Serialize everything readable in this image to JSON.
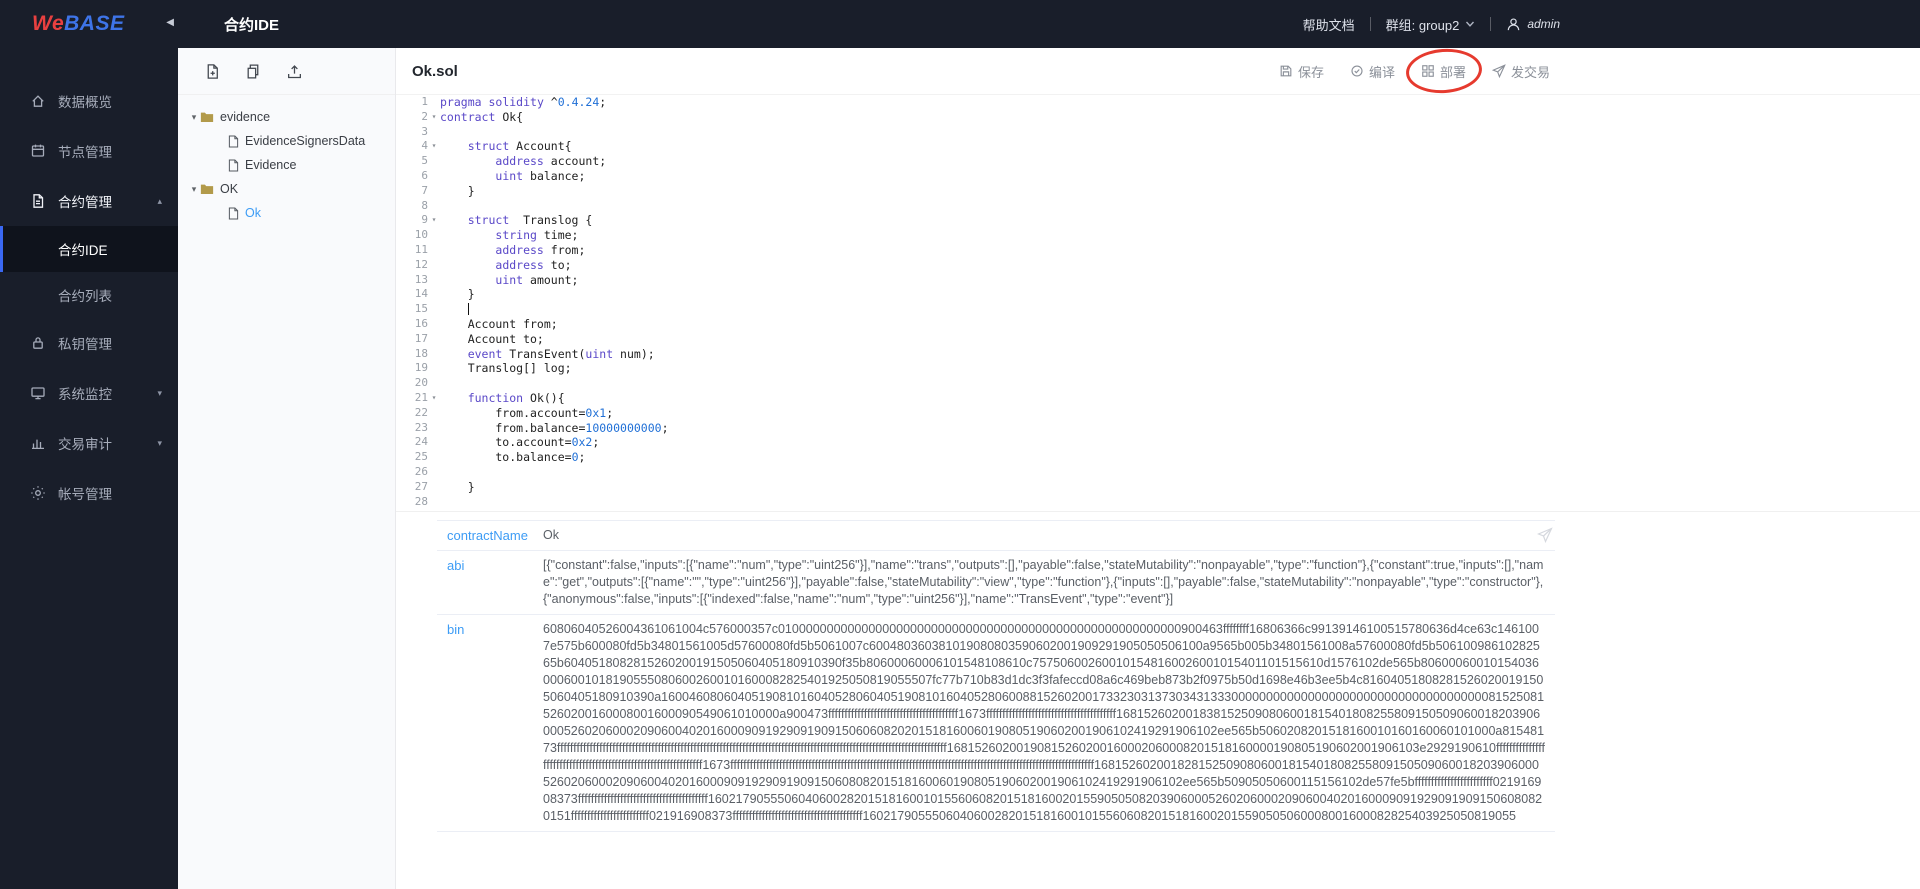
{
  "header": {
    "logo_we": "We",
    "logo_base": "BASE",
    "page_title": "合约IDE",
    "help_link": "帮助文档",
    "group_label": "群组: group2",
    "user_name": "admin"
  },
  "icons": {
    "collapse": "◀",
    "caret_up": "▴",
    "caret_down": "▾",
    "tree_caret": "▾",
    "fold_caret": "▾"
  },
  "sidebar": {
    "items": [
      {
        "label": "数据概览"
      },
      {
        "label": "节点管理"
      },
      {
        "label": "合约管理",
        "expanded": true
      },
      {
        "label": "合约IDE",
        "active": true
      },
      {
        "label": "合约列表"
      },
      {
        "label": "私钥管理"
      },
      {
        "label": "系统监控",
        "collapsed": true
      },
      {
        "label": "交易审计",
        "collapsed": true
      },
      {
        "label": "帐号管理"
      }
    ]
  },
  "file_tree": {
    "folders": [
      {
        "name": "evidence",
        "files": [
          "EvidenceSignersData",
          "Evidence"
        ]
      },
      {
        "name": "OK",
        "files": [
          "Ok"
        ],
        "selected_file": "Ok"
      }
    ]
  },
  "editor": {
    "file_name": "Ok.sol",
    "actions": {
      "save": "保存",
      "compile": "编译",
      "deploy": "部署",
      "send_tx": "发交易"
    },
    "fold_lines": [
      2,
      4,
      9,
      21
    ],
    "cursor_line": 15,
    "lines": [
      "pragma solidity ^0.4.24;",
      "contract Ok{",
      "",
      "    struct Account{",
      "        address account;",
      "        uint balance;",
      "    }",
      "",
      "    struct  Translog {",
      "        string time;",
      "        address from;",
      "        address to;",
      "        uint amount;",
      "    }",
      "    ",
      "    Account from;",
      "    Account to;",
      "    event TransEvent(uint num);",
      "    Translog[] log;",
      "",
      "    function Ok(){",
      "        from.account=0x1;",
      "        from.balance=10000000000;",
      "        to.account=0x2;",
      "        to.balance=0;",
      "",
      "    }",
      ""
    ]
  },
  "output_panel": {
    "rows": [
      {
        "label": "contractName",
        "value": "Ok"
      },
      {
        "label": "abi",
        "value": "[{\"constant\":false,\"inputs\":[{\"name\":\"num\",\"type\":\"uint256\"}],\"name\":\"trans\",\"outputs\":[],\"payable\":false,\"stateMutability\":\"nonpayable\",\"type\":\"function\"},{\"constant\":true,\"inputs\":[],\"name\":\"get\",\"outputs\":[{\"name\":\"\",\"type\":\"uint256\"}],\"payable\":false,\"stateMutability\":\"view\",\"type\":\"function\"},{\"inputs\":[],\"payable\":false,\"stateMutability\":\"nonpayable\",\"type\":\"constructor\"},{\"anonymous\":false,\"inputs\":[{\"indexed\":false,\"name\":\"num\",\"type\":\"uint256\"}],\"name\":\"TransEvent\",\"type\":\"event\"}]"
      },
      {
        "label": "bin",
        "value": "60806040526004361061004c576000357c0100000000000000000000000000000000000000000000000000000000900463ffffffff16806366c99139146100515780636d4ce63c1461007e575b600080fd5b34801561005d57600080fd5b5061007c600480360381019080803590602001909291905050506100a9565b005b34801561008a57600080fd5b50610098610282565b6040518082815260200191505060405180910390f35b80600060006101548108610c757506002600101548160026001015401101515610d1576102de565b8060006001015403600060010181905550806002600101600082825401925050819055507fc77b710b83d1dc3f3fafeccd08a6c469beb873b2f0975b50d1698e46b3ee5b4c816040518082815260200191505060405180910390a16004608060405190810160405280604051908101604052806008815260200173323031373034313330000000000000000000000000000000000000815250815260200160008001600090549061010000a900473ffffffffffffffffffffffffffffffffffffffff1673ffffffffffffffffffffffffffffffffffffffff16815260200183815250908060018154018082558091505090600182039060005260206000209060040201600090919290919091506060820201518160060190805190602001906102419291906102ee565b5060208201518160010160160060101000a81548173ffffffffffffffffffffffffffffffffffffffffffffffffffffffffffffffffffffffffffffffffffffffffffffffffffffffffffffffffffffffff16815260200190815260200160002060008201518160000190805190602001906103e2929190610ffffffffffffffffffffffffffffffffffffffffffffffffffffffffffffffff1673ffffffffffffffffffffffffffffffffffffffffffffffffffffffffffffffffffffffffffffffffffffffffffffffffffffffffffffffff168152602001828152509080600181540180825580915050906001820390600052602060002090600402016000909192909190915060808201518160060190805190602001906102419291906102ee565b50905050600115156102de57fe5bffffffffffffffffffffffff021916908373ffffffffffffffffffffffffffffffffffffffff1602179055506040600282015181600101556060820151816002015590505082039060005260206000209060040201600090919290919091506080820151ffffffffffffffffffffffff021916908373ffffffffffffffffffffffffffffffffffffffff1602179055506040600282015181600101556060820151816002015590505060008001600082825403925050819055"
      }
    ]
  },
  "colors": {
    "header_bg": "#191e2a",
    "active_accent": "#3a68f2",
    "link_blue": "#3d9cf5",
    "annotation_red": "#e63a2e",
    "folder_gold": "#b29a4a",
    "keyword": "#5a48c8",
    "number": "#1f6fd6"
  }
}
